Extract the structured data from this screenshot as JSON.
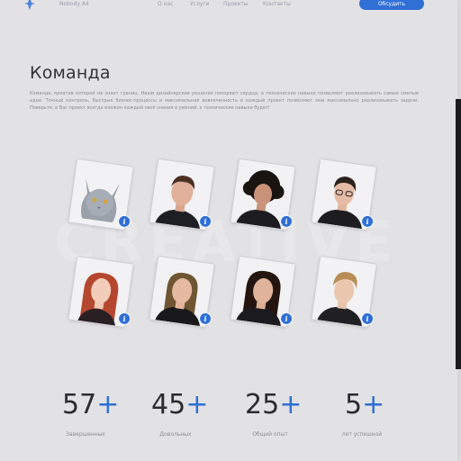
{
  "header": {
    "brand": "Nobody A4",
    "nav": [
      "О нас",
      "Услуги",
      "Проекты",
      "Контакты"
    ],
    "cta_label": "Обсудить"
  },
  "team": {
    "title": "Команда",
    "description": "Команда, креатив которой не знает границ. Наши дизайнерские решения покоряют сердца, а технические навыки позволяют реализовывать самые смелые идеи. Точный контроль, быстрые бизнес-процессы и максимальная вовлеченность в каждый проект позволяют мне максимально реализовывать задачи. Поверьте, в Вас проект всегда вложен каждый своё знания в умений, а технические навыки будет!",
    "watermark": "CREATIVE",
    "members_info_icon": "info-icon"
  },
  "stats": [
    {
      "value": "57",
      "suffix": "+",
      "label": "Завершенных"
    },
    {
      "value": "45",
      "suffix": "+",
      "label": "Довольных"
    },
    {
      "value": "25",
      "suffix": "+",
      "label": "Общий опыт"
    },
    {
      "value": "5",
      "suffix": "+",
      "label": "лет успешной"
    }
  ],
  "colors": {
    "accent": "#2f6fd6",
    "background": "#e2e2e5",
    "text": "#333339"
  }
}
